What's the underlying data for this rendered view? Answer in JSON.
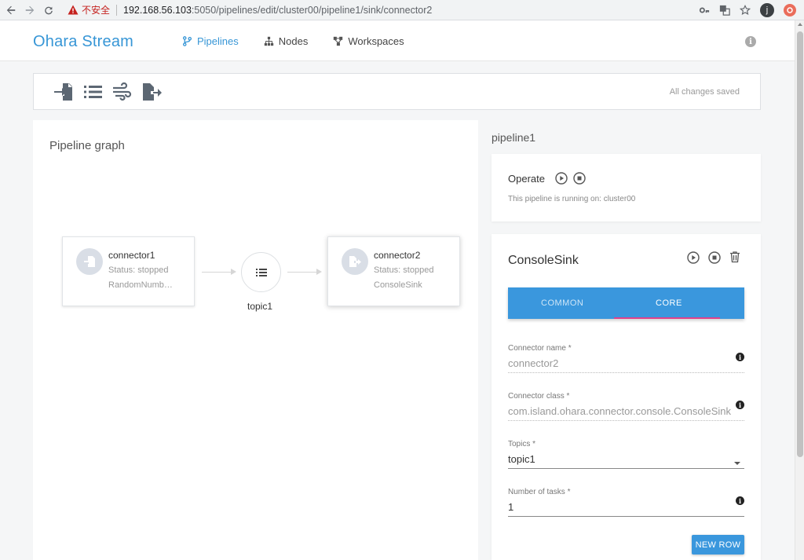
{
  "browser": {
    "insecure_label": "不安全",
    "url_host": "192.168.56.103",
    "url_path": ":5050/pipelines/edit/cluster00/pipeline1/sink/connector2",
    "profile_initial": "j"
  },
  "header": {
    "brand": "Ohara Stream",
    "nav": [
      {
        "label": "Pipelines",
        "icon": "fork-icon",
        "active": true
      },
      {
        "label": "Nodes",
        "icon": "sitemap-icon",
        "active": false
      },
      {
        "label": "Workspaces",
        "icon": "network-icon",
        "active": false
      }
    ]
  },
  "toolbar": {
    "tools": [
      "source-connector-icon",
      "topic-list-icon",
      "stream-icon",
      "sink-connector-icon"
    ],
    "status": "All changes saved"
  },
  "graph": {
    "title": "Pipeline graph",
    "nodes": [
      {
        "name": "connector1",
        "status": "Status: stopped",
        "class": "RandomNumb…"
      },
      {
        "name": "connector2",
        "status": "Status: stopped",
        "class": "ConsoleSink"
      }
    ],
    "topic": {
      "name": "topic1"
    }
  },
  "sidebar": {
    "pipeline_name": "pipeline1",
    "operate": {
      "label": "Operate",
      "running_text": "This pipeline is running on: cluster00"
    },
    "connector": {
      "title": "ConsoleSink",
      "tabs": [
        "COMMON",
        "CORE"
      ],
      "active_tab": "CORE",
      "fields": [
        {
          "label": "Connector name *",
          "value": "connector2"
        },
        {
          "label": "Connector class *",
          "value": "com.island.ohara.connector.console.ConsoleSink"
        },
        {
          "label": "Topics *",
          "value": "topic1"
        },
        {
          "label": "Number of tasks *",
          "value": "1"
        }
      ],
      "new_row_label": "NEW ROW"
    }
  },
  "colors": {
    "brand": "#3796d6",
    "tab_bar": "#3a97dd",
    "tab_indicator": "#e0408b",
    "insecure": "#c5221f"
  }
}
